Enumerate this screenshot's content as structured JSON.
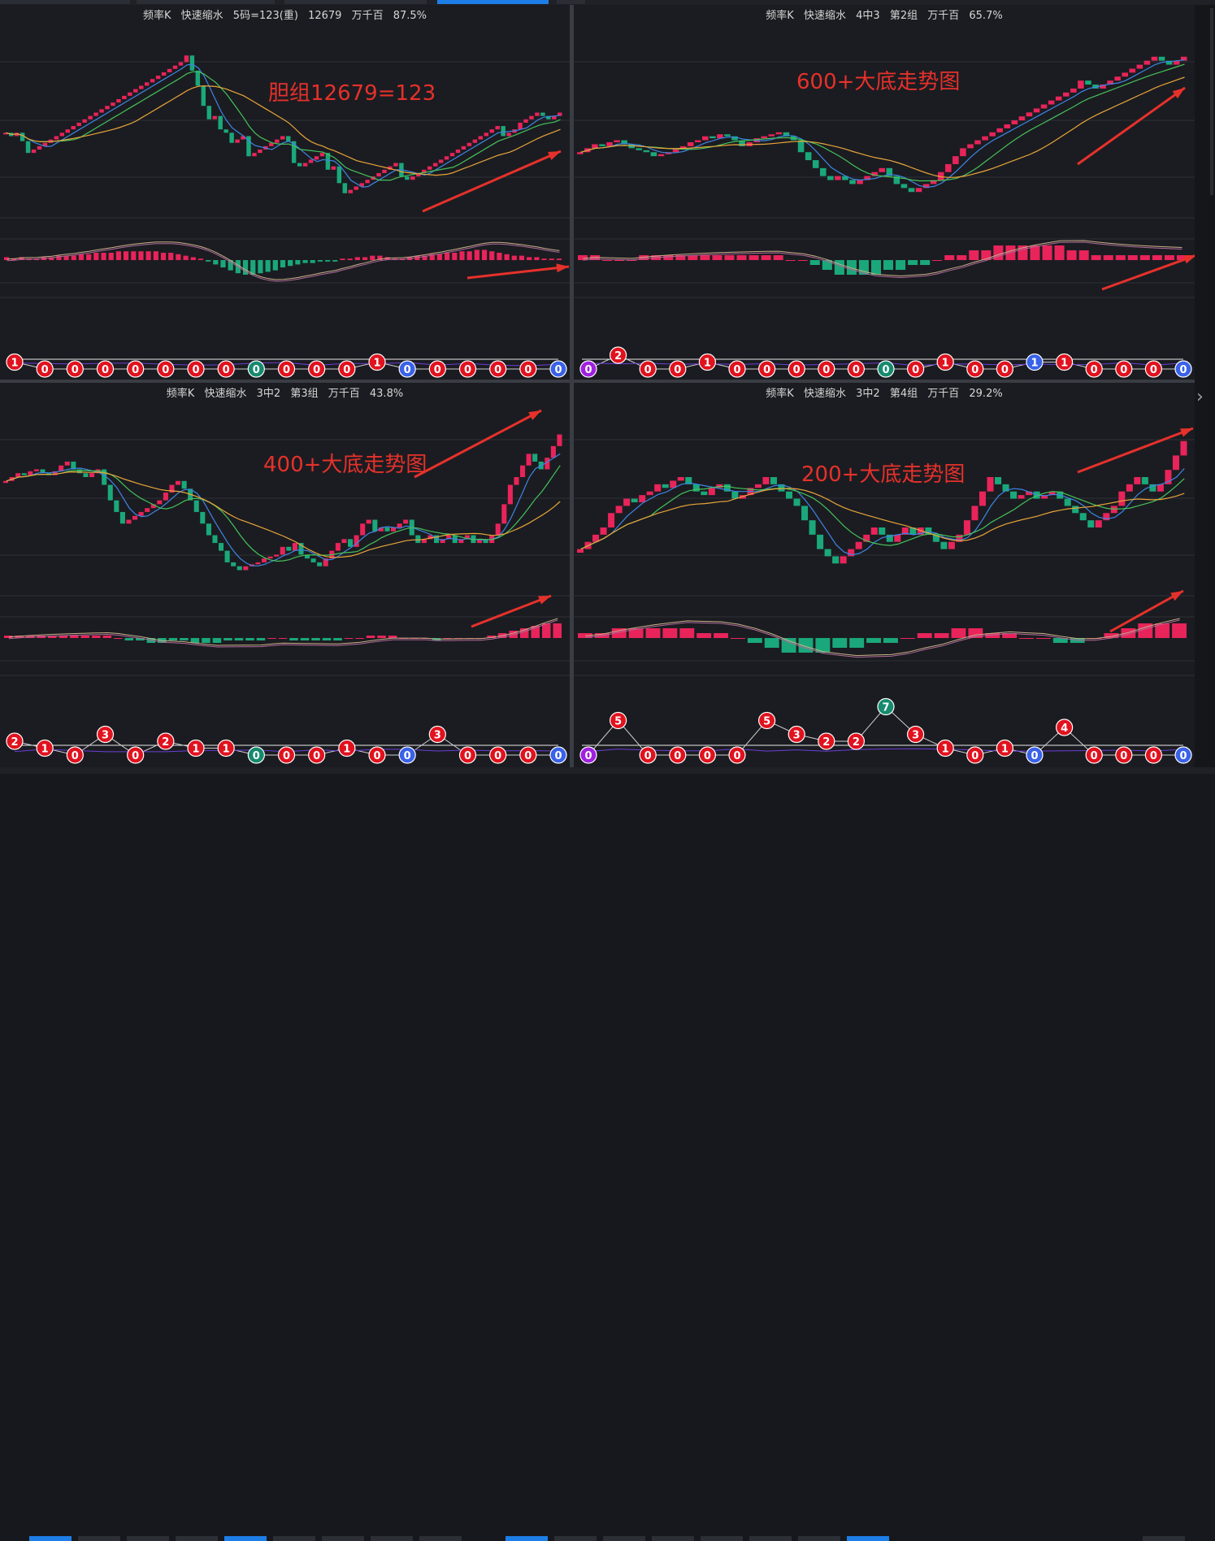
{
  "colors": {
    "up": "#e8245a",
    "down": "#1aa87a",
    "ma5": "#3d86e6",
    "ma10": "#45c25a",
    "ma20": "#e8a53a",
    "arrow": "#e6312b",
    "annotation": "#e6312b",
    "dotRed": "#e0121e",
    "dotBlue": "#3a62e8",
    "dotGreen": "#168a6e",
    "dotPurple": "#a020e0"
  },
  "panels": [
    {
      "title": {
        "name": "频率K",
        "mode": "快速缩水",
        "rule": "5码=123(重)",
        "extra": "12679",
        "unit": "万千百",
        "pct": "87.5%"
      },
      "annotation": "胆组12679=123",
      "chart_data": {
        "type": "candlestick",
        "close": [
          60,
          58,
          60,
          55,
          48,
          50,
          52,
          54,
          56,
          58,
          60,
          62,
          64,
          66,
          68,
          70,
          72,
          74,
          76,
          78,
          80,
          82,
          84,
          86,
          88,
          90,
          92,
          94,
          96,
          98,
          100,
          102,
          106,
          97,
          88,
          76,
          68,
          70,
          62,
          60,
          54,
          56,
          58,
          46,
          48,
          50,
          52,
          54,
          56,
          58,
          55,
          42,
          40,
          42,
          44,
          46,
          48,
          38,
          40,
          30,
          24,
          26,
          28,
          30,
          32,
          34,
          36,
          38,
          40,
          42,
          34,
          32,
          34,
          36,
          38,
          40,
          42,
          44,
          46,
          48,
          50,
          52,
          54,
          56,
          58,
          60,
          62,
          64,
          58,
          60,
          62,
          66,
          68,
          70,
          72,
          70,
          68,
          70,
          72
        ],
        "macd_hist": [
          2,
          1,
          2,
          1,
          1,
          2,
          2,
          3,
          3,
          3,
          4,
          4,
          5,
          5,
          5,
          6,
          6,
          6,
          6,
          6,
          6,
          5,
          5,
          4,
          3,
          2,
          1,
          -1,
          -3,
          -5,
          -7,
          -9,
          -10,
          -10,
          -9,
          -8,
          -7,
          -5,
          -4,
          -3,
          -2,
          -2,
          -1,
          -1,
          -1,
          1,
          1,
          2,
          2,
          3,
          3,
          2,
          1,
          1,
          2,
          3,
          3,
          4,
          4,
          5,
          5,
          6,
          6,
          7,
          7,
          6,
          5,
          4,
          3,
          3,
          2,
          2,
          1,
          1,
          1
        ],
        "dots": [
          {
            "v": "1",
            "c": "red",
            "lvl": 1
          },
          {
            "v": "0",
            "c": "red",
            "lvl": 0
          },
          {
            "v": "0",
            "c": "red",
            "lvl": 0
          },
          {
            "v": "0",
            "c": "red",
            "lvl": 0
          },
          {
            "v": "0",
            "c": "red",
            "lvl": 0
          },
          {
            "v": "0",
            "c": "red",
            "lvl": 0
          },
          {
            "v": "0",
            "c": "red",
            "lvl": 0
          },
          {
            "v": "0",
            "c": "red",
            "lvl": 0
          },
          {
            "v": "0",
            "c": "green",
            "lvl": 0
          },
          {
            "v": "0",
            "c": "red",
            "lvl": 0
          },
          {
            "v": "0",
            "c": "red",
            "lvl": 0
          },
          {
            "v": "0",
            "c": "red",
            "lvl": 0
          },
          {
            "v": "1",
            "c": "red",
            "lvl": 1
          },
          {
            "v": "0",
            "c": "blue",
            "lvl": 0
          },
          {
            "v": "0",
            "c": "red",
            "lvl": 0
          },
          {
            "v": "0",
            "c": "red",
            "lvl": 0
          },
          {
            "v": "0",
            "c": "red",
            "lvl": 0
          },
          {
            "v": "0",
            "c": "red",
            "lvl": 0
          },
          {
            "v": "0",
            "c": "blue",
            "lvl": 0
          }
        ]
      }
    },
    {
      "title": {
        "name": "频率K",
        "mode": "快速缩水",
        "rule": "4中3",
        "extra": "第2组",
        "unit": "万千百",
        "pct": "65.7%"
      },
      "annotation": "600+大底走势图",
      "chart_data": {
        "type": "candlestick",
        "close": [
          52,
          54,
          56,
          55,
          57,
          58,
          56,
          54,
          53,
          52,
          50,
          51,
          52,
          54,
          55,
          57,
          58,
          60,
          59,
          61,
          60,
          58,
          55,
          57,
          59,
          60,
          61,
          62,
          60,
          58,
          52,
          48,
          44,
          40,
          38,
          40,
          38,
          36,
          38,
          40,
          42,
          44,
          40,
          36,
          34,
          32,
          34,
          36,
          38,
          42,
          46,
          50,
          54,
          56,
          58,
          60,
          62,
          64,
          66,
          68,
          70,
          72,
          74,
          76,
          78,
          80,
          82,
          84,
          88,
          86,
          84,
          86,
          88,
          90,
          92,
          94,
          96,
          98,
          100,
          98,
          96,
          98,
          100
        ],
        "macd_hist": [
          1,
          1,
          0,
          0,
          0,
          1,
          1,
          1,
          1,
          1,
          1,
          1,
          1,
          1,
          1,
          1,
          1,
          0,
          0,
          -1,
          -2,
          -3,
          -3,
          -3,
          -3,
          -2,
          -2,
          -1,
          -1,
          0,
          1,
          1,
          2,
          2,
          3,
          3,
          3,
          3,
          3,
          3,
          2,
          2,
          1,
          1,
          1,
          1,
          1,
          1,
          1,
          1
        ],
        "dots": [
          {
            "v": "0",
            "c": "purple",
            "lvl": 0
          },
          {
            "v": "2",
            "c": "red",
            "lvl": 2
          },
          {
            "v": "0",
            "c": "red",
            "lvl": 0
          },
          {
            "v": "0",
            "c": "red",
            "lvl": 0
          },
          {
            "v": "1",
            "c": "red",
            "lvl": 1
          },
          {
            "v": "0",
            "c": "red",
            "lvl": 0
          },
          {
            "v": "0",
            "c": "red",
            "lvl": 0
          },
          {
            "v": "0",
            "c": "red",
            "lvl": 0
          },
          {
            "v": "0",
            "c": "red",
            "lvl": 0
          },
          {
            "v": "0",
            "c": "red",
            "lvl": 0
          },
          {
            "v": "0",
            "c": "green",
            "lvl": 0
          },
          {
            "v": "0",
            "c": "red",
            "lvl": 0
          },
          {
            "v": "1",
            "c": "red",
            "lvl": 1
          },
          {
            "v": "0",
            "c": "red",
            "lvl": 0
          },
          {
            "v": "0",
            "c": "red",
            "lvl": 0
          },
          {
            "v": "1",
            "c": "blue",
            "lvl": 1
          },
          {
            "v": "1",
            "c": "red",
            "lvl": 1
          },
          {
            "v": "0",
            "c": "red",
            "lvl": 0
          },
          {
            "v": "0",
            "c": "red",
            "lvl": 0
          },
          {
            "v": "0",
            "c": "red",
            "lvl": 0
          },
          {
            "v": "0",
            "c": "blue",
            "lvl": 0
          }
        ]
      }
    },
    {
      "title": {
        "name": "频率K",
        "mode": "快速缩水",
        "rule": "3中2",
        "extra": "第3组",
        "unit": "万千百",
        "pct": "43.8%"
      },
      "annotation": "400+大底走势图",
      "chart_data": {
        "type": "candlestick",
        "close": [
          62,
          64,
          66,
          65,
          67,
          68,
          66,
          65,
          67,
          70,
          72,
          68,
          66,
          64,
          66,
          68,
          60,
          52,
          46,
          40,
          42,
          44,
          46,
          48,
          50,
          52,
          56,
          60,
          62,
          58,
          52,
          46,
          40,
          34,
          30,
          26,
          20,
          18,
          16,
          18,
          19,
          20,
          22,
          23,
          24,
          28,
          26,
          30,
          24,
          22,
          20,
          18,
          22,
          26,
          30,
          32,
          28,
          34,
          40,
          42,
          36,
          38,
          36,
          38,
          40,
          42,
          34,
          30,
          32,
          34,
          30,
          32,
          34,
          30,
          32,
          34,
          30,
          32,
          30,
          34,
          40,
          50,
          60,
          64,
          70,
          76,
          72,
          68,
          74,
          80,
          86
        ],
        "macd_hist": [
          1,
          1,
          1,
          1,
          1,
          1,
          1,
          1,
          1,
          1,
          0,
          -1,
          -1,
          -2,
          -2,
          -1,
          -1,
          -2,
          -2,
          -2,
          -1,
          -1,
          -1,
          -1,
          0,
          0,
          -1,
          -1,
          -1,
          -1,
          -1,
          0,
          0,
          1,
          1,
          1,
          0,
          0,
          0,
          -1,
          0,
          0,
          0,
          0,
          1,
          2,
          3,
          4,
          5,
          6,
          6
        ],
        "dots": [
          {
            "v": "2",
            "c": "red",
            "lvl": 2
          },
          {
            "v": "1",
            "c": "red",
            "lvl": 1
          },
          {
            "v": "0",
            "c": "red",
            "lvl": 0
          },
          {
            "v": "3",
            "c": "red",
            "lvl": 3
          },
          {
            "v": "0",
            "c": "red",
            "lvl": 0
          },
          {
            "v": "2",
            "c": "red",
            "lvl": 2
          },
          {
            "v": "1",
            "c": "red",
            "lvl": 1
          },
          {
            "v": "1",
            "c": "red",
            "lvl": 1
          },
          {
            "v": "0",
            "c": "green",
            "lvl": 0
          },
          {
            "v": "0",
            "c": "red",
            "lvl": 0
          },
          {
            "v": "0",
            "c": "red",
            "lvl": 0
          },
          {
            "v": "1",
            "c": "red",
            "lvl": 1
          },
          {
            "v": "0",
            "c": "red",
            "lvl": 0
          },
          {
            "v": "0",
            "c": "blue",
            "lvl": 0
          },
          {
            "v": "3",
            "c": "red",
            "lvl": 3
          },
          {
            "v": "0",
            "c": "red",
            "lvl": 0
          },
          {
            "v": "0",
            "c": "red",
            "lvl": 0
          },
          {
            "v": "0",
            "c": "red",
            "lvl": 0
          },
          {
            "v": "0",
            "c": "blue",
            "lvl": 0
          }
        ]
      }
    },
    {
      "title": {
        "name": "频率K",
        "mode": "快速缩水",
        "rule": "3中2",
        "extra": "第4组",
        "unit": "万千百",
        "pct": "29.2%"
      },
      "annotation": "200+大底走势图",
      "chart_data": {
        "type": "candlestick",
        "close": [
          40,
          42,
          44,
          46,
          50,
          52,
          54,
          53,
          55,
          56,
          58,
          57,
          59,
          60,
          58,
          56,
          55,
          57,
          58,
          56,
          54,
          55,
          57,
          58,
          60,
          58,
          56,
          54,
          52,
          48,
          44,
          40,
          38,
          36,
          38,
          40,
          42,
          44,
          46,
          44,
          42,
          44,
          46,
          44,
          46,
          44,
          42,
          40,
          42,
          44,
          48,
          52,
          56,
          60,
          58,
          56,
          54,
          55,
          56,
          54,
          55,
          56,
          54,
          52,
          50,
          48,
          46,
          48,
          50,
          52,
          56,
          58,
          60,
          58,
          56,
          58,
          62,
          66,
          70
        ],
        "macd_hist": [
          1,
          1,
          2,
          2,
          2,
          2,
          2,
          1,
          1,
          0,
          -1,
          -2,
          -3,
          -3,
          -3,
          -2,
          -2,
          -1,
          -1,
          0,
          1,
          1,
          2,
          2,
          1,
          1,
          0,
          0,
          -1,
          -1,
          0,
          1,
          2,
          3,
          3,
          3
        ],
        "dots": [
          {
            "v": "0",
            "c": "purple",
            "lvl": 0
          },
          {
            "v": "5",
            "c": "red",
            "lvl": 5
          },
          {
            "v": "0",
            "c": "red",
            "lvl": 0
          },
          {
            "v": "0",
            "c": "red",
            "lvl": 0
          },
          {
            "v": "0",
            "c": "red",
            "lvl": 0
          },
          {
            "v": "0",
            "c": "red",
            "lvl": 0
          },
          {
            "v": "5",
            "c": "red",
            "lvl": 5
          },
          {
            "v": "3",
            "c": "red",
            "lvl": 3
          },
          {
            "v": "2",
            "c": "red",
            "lvl": 2
          },
          {
            "v": "2",
            "c": "red",
            "lvl": 2
          },
          {
            "v": "7",
            "c": "green",
            "lvl": 7
          },
          {
            "v": "3",
            "c": "red",
            "lvl": 3
          },
          {
            "v": "1",
            "c": "red",
            "lvl": 1
          },
          {
            "v": "0",
            "c": "red",
            "lvl": 0
          },
          {
            "v": "1",
            "c": "red",
            "lvl": 1
          },
          {
            "v": "0",
            "c": "blue",
            "lvl": 0
          },
          {
            "v": "4",
            "c": "red",
            "lvl": 4
          },
          {
            "v": "0",
            "c": "red",
            "lvl": 0
          },
          {
            "v": "0",
            "c": "red",
            "lvl": 0
          },
          {
            "v": "0",
            "c": "red",
            "lvl": 0
          },
          {
            "v": "0",
            "c": "blue",
            "lvl": 0
          }
        ]
      }
    }
  ]
}
